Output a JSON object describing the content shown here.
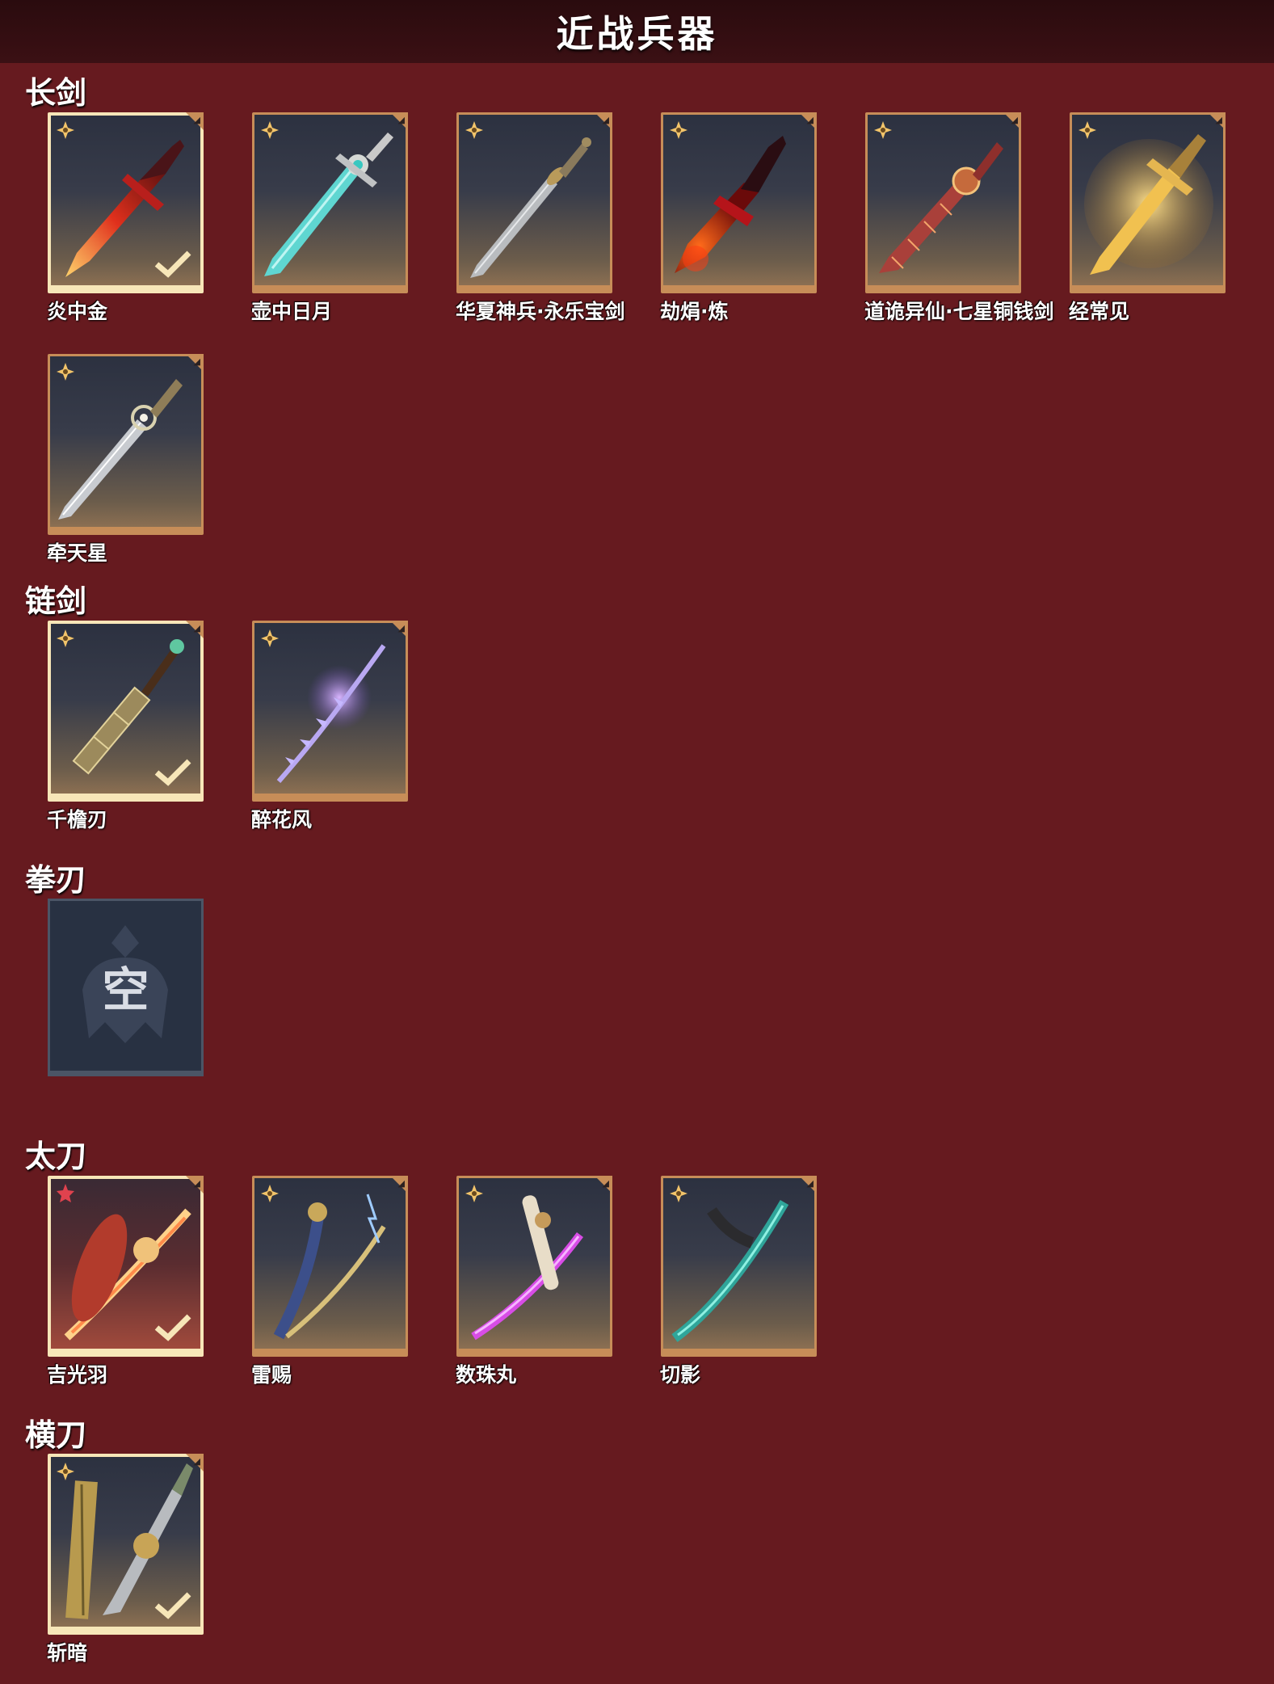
{
  "header": {
    "title": "近战兵器"
  },
  "sections": [
    {
      "title": "长剑",
      "items": [
        {
          "name": "炎中金",
          "equipped": true,
          "star": "gold-star-icon",
          "weapon": "fire-sword-icon"
        },
        {
          "name": "壶中日月",
          "equipped": false,
          "star": "gold-star-icon",
          "weapon": "jade-sword-icon"
        },
        {
          "name": "华夏神兵·永乐宝剑",
          "equipped": false,
          "star": "gold-star-icon",
          "weapon": "steel-sword-icon"
        },
        {
          "name": "劫焆·炼",
          "equipped": false,
          "star": "gold-star-icon",
          "weapon": "flame-blade-icon"
        },
        {
          "name": "道诡异仙·七星铜钱剑",
          "equipped": false,
          "star": "gold-star-icon",
          "weapon": "coin-sword-icon"
        },
        {
          "name": "经常见",
          "equipped": false,
          "star": "gold-star-icon",
          "weapon": "golden-sword-icon"
        },
        {
          "name": "牵天星",
          "equipped": false,
          "star": "gold-star-icon",
          "weapon": "silver-sword-icon"
        }
      ]
    },
    {
      "title": "链剑",
      "items": [
        {
          "name": "千檐刃",
          "equipped": true,
          "star": "gold-star-icon",
          "weapon": "chain-sword-icon"
        },
        {
          "name": "醉花风",
          "equipped": false,
          "star": "gold-star-icon",
          "weapon": "violet-chain-sword-icon"
        }
      ]
    },
    {
      "title": "拳刃",
      "items": [],
      "empty_label": "空"
    },
    {
      "title": "太刀",
      "items": [
        {
          "name": "吉光羽",
          "equipped": true,
          "star": "red-star-icon",
          "weapon": "flame-katana-icon"
        },
        {
          "name": "雷赐",
          "equipped": false,
          "star": "gold-star-icon",
          "weapon": "thunder-katana-icon"
        },
        {
          "name": "数珠丸",
          "equipped": false,
          "star": "gold-star-icon",
          "weapon": "purple-katana-icon"
        },
        {
          "name": "切影",
          "equipped": false,
          "star": "gold-star-icon",
          "weapon": "jade-katana-icon"
        }
      ]
    },
    {
      "title": "横刀",
      "items": [
        {
          "name": "斩暗",
          "equipped": true,
          "star": "gold-star-icon",
          "weapon": "bronze-saber-icon"
        }
      ]
    }
  ],
  "colors": {
    "background": "#661a1f",
    "card_border": "#c78d58",
    "equipped_border": "#f7e6b8",
    "star_gold": "#f2c46a",
    "star_red": "#e0424e"
  }
}
